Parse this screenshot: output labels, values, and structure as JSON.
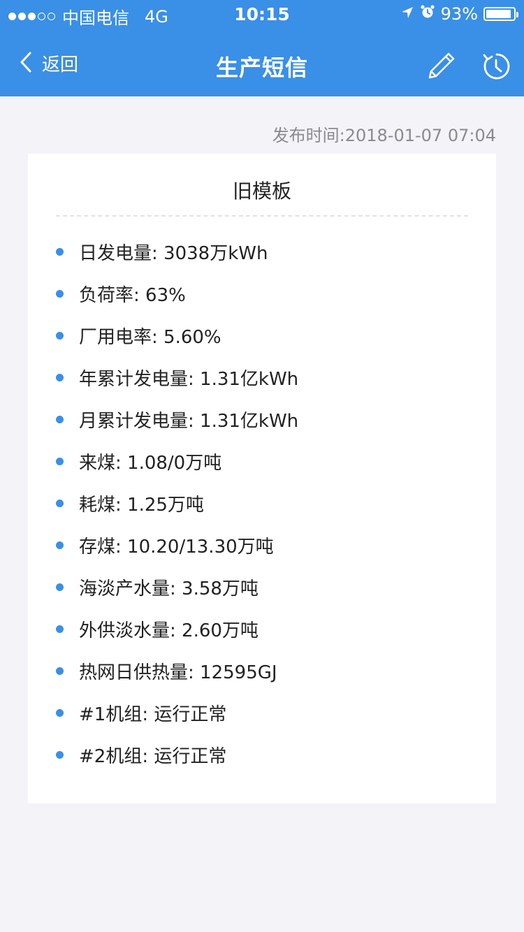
{
  "status_bar": {
    "carrier": "中国电信",
    "network": "4G",
    "time": "10:15",
    "battery": "93%",
    "battery_level": 0.93
  },
  "nav": {
    "back_label": "返回",
    "title": "生产短信"
  },
  "publish_time": "发布时间:2018-01-07 07:04",
  "card": {
    "title": "旧模板",
    "items": [
      "日发电量: 3038万kWh",
      "负荷率: 63%",
      "厂用电率: 5.60%",
      "年累计发电量: 1.31亿kWh",
      "月累计发电量: 1.31亿kWh",
      "来煤: 1.08/0万吨",
      "耗煤: 1.25万吨",
      "存煤: 10.20/13.30万吨",
      "海淡产水量: 3.58万吨",
      "外供淡水量: 2.60万吨",
      "热网日供热量: 12595GJ",
      "#1机组: 运行正常",
      "#2机组: 运行正常"
    ]
  },
  "colors": {
    "accent": "#3a8fe6",
    "background": "#f3f3f8",
    "muted_text": "#8a8a8f"
  },
  "icons": {
    "back": "chevron-left-icon",
    "edit": "pencil-icon",
    "history": "history-clock-icon",
    "location": "location-arrow-icon",
    "alarm": "alarm-icon"
  }
}
